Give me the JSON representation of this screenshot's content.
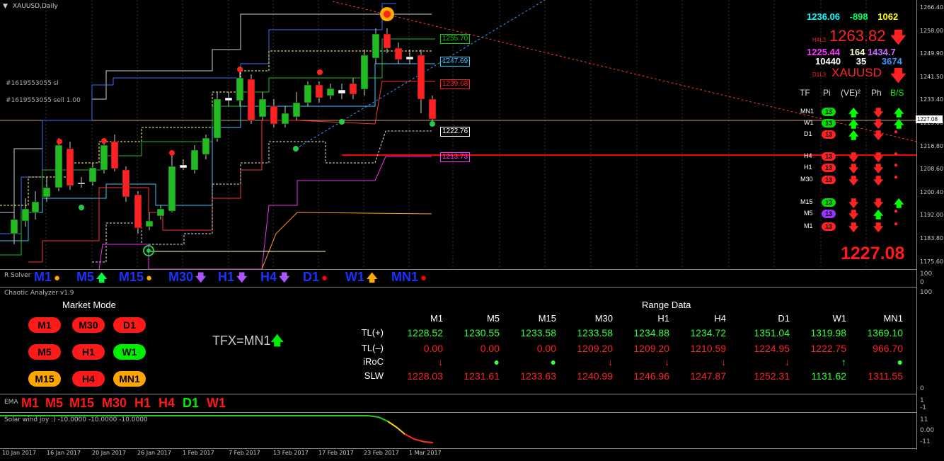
{
  "chart_header": {
    "symbol": "XAUUSD,Daily"
  },
  "order_labels": [
    "#1619553055 sl",
    "#1619553055 sell 1.00"
  ],
  "price_tags": [
    {
      "text": "1255.70",
      "color": "#00d000"
    },
    {
      "text": "1247.69",
      "color": "#33ccff"
    },
    {
      "text": "1239.68",
      "color": "#ff2222"
    },
    {
      "text": "1222.76",
      "color": "#ffffff"
    },
    {
      "text": "1213.73",
      "color": "#ff33ff"
    }
  ],
  "price_axis": [
    "1266.40",
    "1258.00",
    "1249.90",
    "1241.50",
    "1233.40",
    "1225.00",
    "1216.80",
    "1208.60",
    "1200.40",
    "1192.00",
    "1183.80",
    "1175.60"
  ],
  "current_price_tag": "1227.08",
  "info_panel": {
    "row1": [
      "1236.06",
      "-898",
      "1062"
    ],
    "row1_colors": [
      "#00ffff",
      "#00ff66",
      "#ffff00"
    ],
    "h4l3_label": "H4L3",
    "h4l3_value": "1263.82",
    "row2": [
      "1225.44",
      "164",
      "1434.7"
    ],
    "row2_colors": [
      "#ff33ff",
      "#ffffcc",
      "#cc66ff"
    ],
    "row3": [
      "10440",
      "35",
      "3674"
    ],
    "row3_colors": [
      "#ffffff",
      "#ffffff",
      "#3399ff"
    ],
    "d1l3_label": "D1L3",
    "d1l3_value": "XAUUSD",
    "big_price": "1227.08"
  },
  "tf_grid": {
    "headers": [
      "TF",
      "Pi",
      "(VE)²",
      "Ph",
      "B/S"
    ],
    "rows": [
      {
        "tf": "MN1",
        "badge": "13",
        "badge_color": "#00e000",
        "ve": "up",
        "ph": "down",
        "bs": "up"
      },
      {
        "tf": "W1",
        "badge": "13",
        "badge_color": "#00e000",
        "ve": "up",
        "ph": "down",
        "bs": "up"
      },
      {
        "tf": "D1",
        "badge": "13",
        "badge_color": "#ff2222",
        "ve": "up",
        "ph": "down",
        "bs": "dot"
      },
      {
        "tf": "H4",
        "badge": "13",
        "badge_color": "#ff2222",
        "ve": "down",
        "ph": "down",
        "bs": "dot"
      },
      {
        "tf": "H1",
        "badge": "13",
        "badge_color": "#ff2222",
        "ve": "down",
        "ph": "down",
        "bs": "dot"
      },
      {
        "tf": "M30",
        "badge": "13",
        "badge_color": "#ff2222",
        "ve": "down",
        "ph": "down",
        "bs": "dot"
      },
      {
        "tf": "M15",
        "badge": "13",
        "badge_color": "#00e000",
        "ve": "down",
        "ph": "down",
        "bs": "up"
      },
      {
        "tf": "M5",
        "badge": "13",
        "badge_color": "#9933ff",
        "ve": "down",
        "ph": "up",
        "bs": "dot"
      },
      {
        "tf": "M1",
        "badge": "13",
        "badge_color": "#ff2222",
        "ve": "down",
        "ph": "down",
        "bs": "dot"
      }
    ]
  },
  "solver_bar": {
    "name": "R Solver",
    "items": [
      {
        "tf": "M1",
        "sym": "●",
        "color": "#ffaa00"
      },
      {
        "tf": "M5",
        "sym": "🡅",
        "color": "#00ff44"
      },
      {
        "tf": "M15",
        "sym": "●",
        "color": "#ffaa00"
      },
      {
        "tf": "M30",
        "sym": "🡇",
        "color": "#aa55ff"
      },
      {
        "tf": "H1",
        "sym": "🡇",
        "color": "#aa55ff"
      },
      {
        "tf": "H4",
        "sym": "🡇",
        "color": "#aa55ff"
      },
      {
        "tf": "D1",
        "sym": "●",
        "color": "#ff0000"
      },
      {
        "tf": "W1",
        "sym": "🡅",
        "color": "#ffaa00"
      },
      {
        "tf": "MN1",
        "sym": "●",
        "color": "#ff0000"
      }
    ],
    "scale": [
      "100",
      "0"
    ]
  },
  "chaotic": {
    "title": "Chaotic Analyzer v1.9",
    "market_mode_title": "Market Mode",
    "pills": [
      {
        "label": "M1",
        "color": "#ff1a1a"
      },
      {
        "label": "M30",
        "color": "#ff1a1a"
      },
      {
        "label": "D1",
        "color": "#ff1a1a"
      },
      {
        "label": "M5",
        "color": "#ff1a1a"
      },
      {
        "label": "H1",
        "color": "#ff1a1a"
      },
      {
        "label": "W1",
        "color": "#00ee00"
      },
      {
        "label": "M15",
        "color": "#ffa500"
      },
      {
        "label": "H4",
        "color": "#ff1a1a"
      },
      {
        "label": "MN1",
        "color": "#ffa500"
      }
    ],
    "tfx": "TFX=MN1",
    "range_title": "Range Data",
    "columns": [
      "M1",
      "M5",
      "M15",
      "M30",
      "H1",
      "H4",
      "D1",
      "W1",
      "MN1"
    ],
    "rows": [
      {
        "label": "TL(+)",
        "values": [
          "1228.52",
          "1230.55",
          "1233.58",
          "1233.58",
          "1234.88",
          "1234.72",
          "1351.04",
          "1319.98",
          "1369.10"
        ],
        "colors": [
          "#33ff33",
          "#33ff33",
          "#33ff33",
          "#33ff33",
          "#33ff33",
          "#33ff33",
          "#33ff33",
          "#33ff33",
          "#33ff33"
        ]
      },
      {
        "label": "TL(–)",
        "values": [
          "0.00",
          "0.00",
          "0.00",
          "1209.20",
          "1209.20",
          "1210.59",
          "1224.95",
          "1222.75",
          "966.70"
        ],
        "colors": [
          "#ff2222",
          "#ff2222",
          "#ff2222",
          "#ff2222",
          "#ff2222",
          "#ff2222",
          "#ff2222",
          "#ff2222",
          "#ff2222"
        ]
      },
      {
        "label": "iRoC",
        "values": [
          "↓",
          "●",
          "●",
          "↓",
          "↓",
          "↓",
          "↓",
          "↑",
          "●"
        ],
        "colors": [
          "#ff2222",
          "#33ff33",
          "#33ff33",
          "#ff2222",
          "#ff2222",
          "#ff2222",
          "#ff2222",
          "#33ff33",
          "#33ff33"
        ]
      },
      {
        "label": "SLW",
        "values": [
          "1228.03",
          "1231.61",
          "1233.63",
          "1240.99",
          "1246.96",
          "1247.87",
          "1252.31",
          "1131.62",
          "1311.55"
        ],
        "colors": [
          "#ff2222",
          "#ff2222",
          "#ff2222",
          "#ff2222",
          "#ff2222",
          "#ff2222",
          "#ff2222",
          "#33ff33",
          "#ff2222"
        ]
      }
    ],
    "scale": [
      "100",
      "0"
    ]
  },
  "ema_bar": {
    "name": "EMA",
    "items": [
      {
        "tf": "M1",
        "color": "#ff1a1a"
      },
      {
        "tf": "M5",
        "color": "#ff1a1a"
      },
      {
        "tf": "M15",
        "color": "#ff1a1a"
      },
      {
        "tf": "M30",
        "color": "#ff1a1a"
      },
      {
        "tf": "H1",
        "color": "#ff1a1a"
      },
      {
        "tf": "H4",
        "color": "#ff1a1a"
      },
      {
        "tf": "D1",
        "color": "#00ee00"
      },
      {
        "tf": "W1",
        "color": "#ff1a1a"
      }
    ],
    "scale": [
      "1",
      "-1"
    ]
  },
  "solar": {
    "title": "Solar wind joy :) -10.0000 -10.0000 -10.0000",
    "scale": [
      "11",
      "0.00",
      "-11"
    ]
  },
  "time_axis": [
    "10 Jan 2017",
    "16 Jan 2017",
    "20 Jan 2017",
    "26 Jan 2017",
    "1 Feb 2017",
    "7 Feb 2017",
    "13 Feb 2017",
    "17 Feb 2017",
    "23 Feb 2017",
    "1 Mar 2017"
  ]
}
